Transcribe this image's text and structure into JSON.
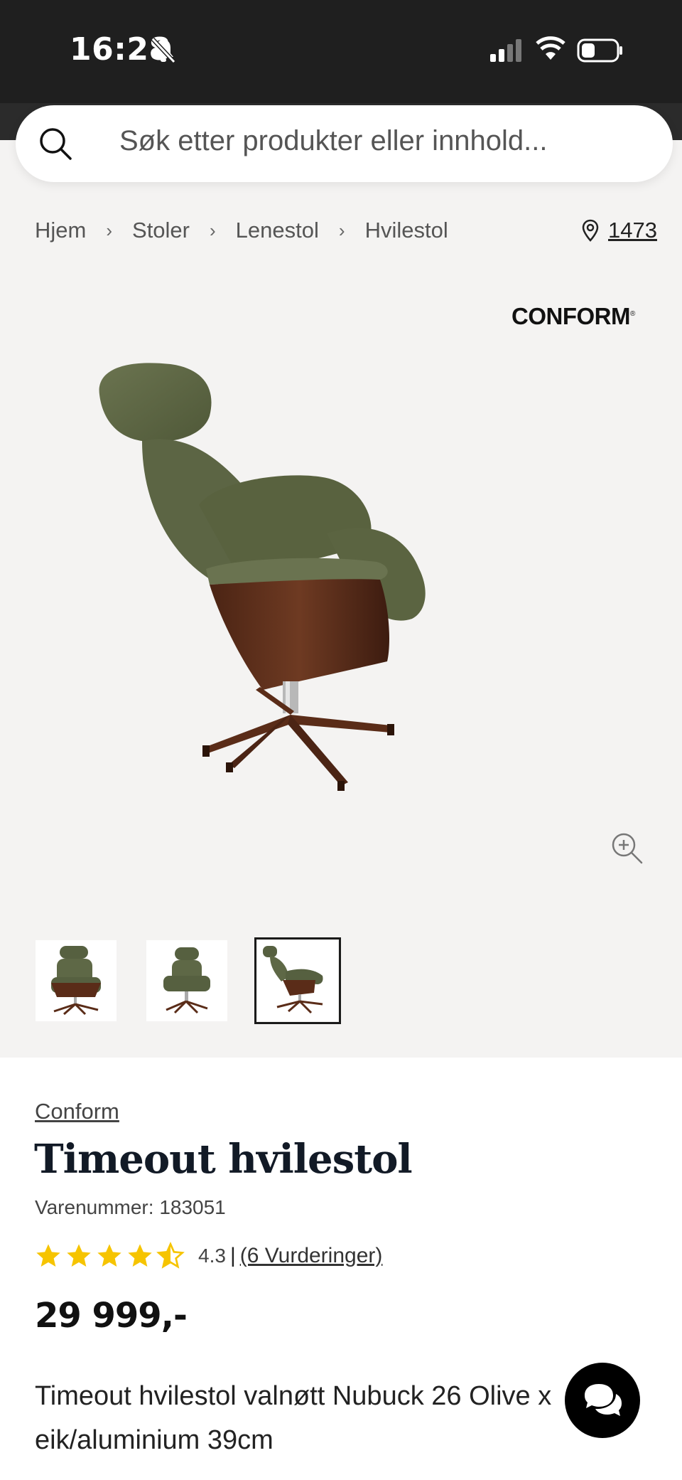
{
  "status_bar": {
    "time": "16:28"
  },
  "search": {
    "placeholder": "Søk etter produkter eller innhold..."
  },
  "breadcrumb": [
    "Hjem",
    "Stoler",
    "Lenestol",
    "Hvilestol"
  ],
  "store": {
    "number": "1473"
  },
  "gallery": {
    "brand_logo": "CONFORM",
    "thumbnails": 3,
    "active_thumbnail": 3
  },
  "product": {
    "brand": "Conform",
    "title": "Timeout hvilestol",
    "sku_label": "Varenummer: 183051",
    "rating_value": 4.3,
    "rating_text": "4.3",
    "reviews": "(6 Vurderinger)",
    "price": "29 999,-",
    "description": "Timeout hvilestol valnøtt Nubuck 26 Olive x eik/aluminium 39cm"
  },
  "colors": {
    "star": "#f6c400",
    "background_gallery": "#f4f3f2",
    "status_bar": "#1f1f1f"
  },
  "icons": [
    "bell-slash-icon",
    "signal-icon",
    "wifi-icon",
    "battery-icon",
    "search-icon",
    "chevron-right-icon",
    "location-pin-icon",
    "zoom-in-icon",
    "star-icon",
    "chat-icon"
  ]
}
